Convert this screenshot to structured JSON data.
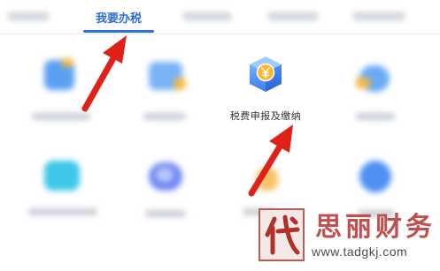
{
  "tabs": {
    "active_label": "我要办税"
  },
  "featured_item": {
    "label": "税费申报及缴纳",
    "icon": "tax-yuan-cube-icon"
  },
  "annotations": {
    "arrow_color": "#e0211a"
  },
  "watermark": {
    "seal_char": "代",
    "brand": "思丽财务",
    "url": "www.tadgkj.com"
  }
}
